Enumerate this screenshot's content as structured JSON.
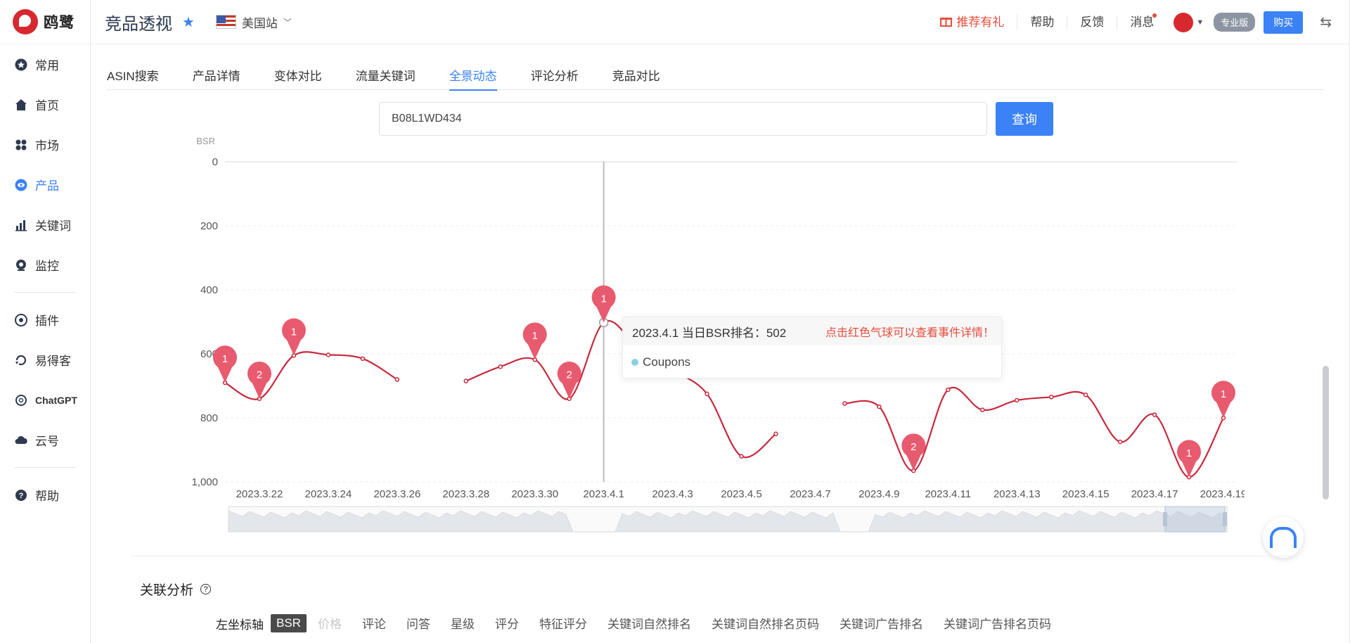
{
  "app": {
    "logo_text": "鸥鹭",
    "page_title": "竞品透视",
    "site": "美国站"
  },
  "sidebar": {
    "items": [
      {
        "label": "常用",
        "icon": "star-badge-icon"
      },
      {
        "label": "首页",
        "icon": "home-icon"
      },
      {
        "label": "市场",
        "icon": "grid-icon"
      },
      {
        "label": "产品",
        "icon": "eye-icon",
        "active": true
      },
      {
        "label": "关键词",
        "icon": "bar-chart-icon"
      },
      {
        "label": "监控",
        "icon": "camera-icon"
      }
    ],
    "tools": [
      {
        "label": "插件",
        "icon": "chrome-icon"
      },
      {
        "label": "易得客",
        "icon": "refresh-icon"
      },
      {
        "label": "ChatGPT",
        "icon": "chatgpt-icon"
      },
      {
        "label": "云号",
        "icon": "cloud-icon"
      }
    ],
    "help": {
      "label": "帮助",
      "icon": "help-icon"
    }
  },
  "header": {
    "reward": "推荐有礼",
    "help": "帮助",
    "feedback": "反馈",
    "messages": "消息",
    "pro": "专业版",
    "buy": "购买"
  },
  "tabs": [
    {
      "label": "ASIN搜索"
    },
    {
      "label": "产品详情"
    },
    {
      "label": "变体对比"
    },
    {
      "label": "流量关键词"
    },
    {
      "label": "全景动态",
      "active": true
    },
    {
      "label": "评论分析"
    },
    {
      "label": "竞品对比"
    }
  ],
  "search": {
    "value": "B08L1WD434",
    "button": "查询"
  },
  "chart_data": {
    "type": "line",
    "ylabel": "BSR",
    "y_inverted": true,
    "ylim": [
      0,
      1000
    ],
    "yticks": [
      "0",
      "200",
      "400",
      "600",
      "800",
      "1,000"
    ],
    "xticks": [
      "2023.3.22",
      "2023.3.24",
      "2023.3.26",
      "2023.3.28",
      "2023.3.30",
      "2023.4.1",
      "2023.4.3",
      "2023.4.5",
      "2023.4.7",
      "2023.4.9",
      "2023.4.11",
      "2023.4.13",
      "2023.4.15",
      "2023.4.17",
      "2023.4.19"
    ],
    "line_color": "#c8283c",
    "segments": [
      [
        [
          "2023.3.21",
          690
        ],
        [
          "2023.3.22",
          740
        ],
        [
          "2023.3.23",
          605
        ],
        [
          "2023.3.24",
          603
        ],
        [
          "2023.3.25",
          615
        ],
        [
          "2023.3.26",
          680
        ]
      ],
      [
        [
          "2023.3.28",
          685
        ],
        [
          "2023.3.29",
          640
        ],
        [
          "2023.3.30",
          618
        ],
        [
          "2023.3.31",
          740
        ],
        [
          "2023.4.1",
          502
        ],
        [
          "2023.4.2",
          580
        ],
        [
          "2023.4.3",
          650
        ],
        [
          "2023.4.4",
          725
        ],
        [
          "2023.4.5",
          920
        ],
        [
          "2023.4.6",
          850
        ]
      ],
      [
        [
          "2023.4.8",
          755
        ],
        [
          "2023.4.9",
          765
        ],
        [
          "2023.4.10",
          965
        ],
        [
          "2023.4.11",
          712
        ],
        [
          "2023.4.12",
          775
        ],
        [
          "2023.4.13",
          745
        ],
        [
          "2023.4.14",
          735
        ],
        [
          "2023.4.15",
          728
        ],
        [
          "2023.4.16",
          875
        ],
        [
          "2023.4.17",
          790
        ],
        [
          "2023.4.18",
          985
        ],
        [
          "2023.4.19",
          800
        ]
      ]
    ],
    "event_markers": [
      {
        "x": "2023.3.21",
        "y": 690,
        "label": "1"
      },
      {
        "x": "2023.3.22",
        "y": 740,
        "label": "2"
      },
      {
        "x": "2023.3.23",
        "y": 605,
        "label": "1"
      },
      {
        "x": "2023.3.30",
        "y": 618,
        "label": "1"
      },
      {
        "x": "2023.3.31",
        "y": 740,
        "label": "2"
      },
      {
        "x": "2023.4.1",
        "y": 502,
        "label": "1"
      },
      {
        "x": "2023.4.10",
        "y": 965,
        "label": "2"
      },
      {
        "x": "2023.4.18",
        "y": 985,
        "label": "1"
      },
      {
        "x": "2023.4.19",
        "y": 800,
        "label": "1"
      }
    ],
    "marker_color": "#e85a6e",
    "hover": {
      "x": "2023.4.1",
      "y": 502
    },
    "tooltip": {
      "title": "2023.4.1 当日BSR排名：502",
      "hint": "点击红色气球可以查看事件详情！",
      "series": "Coupons",
      "series_color": "#8ad1e0"
    }
  },
  "assoc": {
    "title": "关联分析",
    "axis_label": "左坐标轴",
    "options": [
      {
        "label": "BSR",
        "selected": true
      },
      {
        "label": "价格",
        "disabled": true
      },
      {
        "label": "评论"
      },
      {
        "label": "问答"
      },
      {
        "label": "星级"
      },
      {
        "label": "评分"
      },
      {
        "label": "特征评分"
      },
      {
        "label": "关键词自然排名"
      },
      {
        "label": "关键词自然排名页码"
      },
      {
        "label": "关键词广告排名"
      },
      {
        "label": "关键词广告排名页码"
      }
    ]
  }
}
